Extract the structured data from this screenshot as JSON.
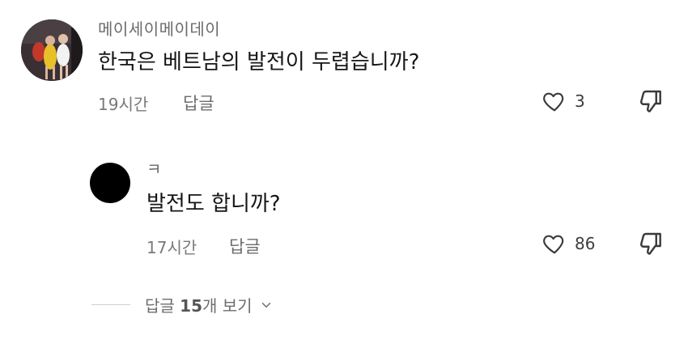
{
  "comments": [
    {
      "username": "메이세이메이데이",
      "text": "한국은 베트남의 발전이 두렵습니까?",
      "time": "19시간",
      "reply_label": "답글",
      "likes": "3"
    },
    {
      "username": "ㅋ",
      "text": "발전도 합니까?",
      "time": "17시간",
      "reply_label": "답글",
      "likes": "86"
    }
  ],
  "view_replies": {
    "prefix": "답글 ",
    "count": "15",
    "suffix": "개 보기"
  },
  "icons": {
    "like": "heart-outline-icon",
    "dislike": "thumbs-down-outline-icon",
    "expand": "chevron-down-icon"
  },
  "colors": {
    "text_primary": "#161616",
    "text_secondary": "#7a7a7a",
    "icon_stroke": "#3a3a3a"
  }
}
